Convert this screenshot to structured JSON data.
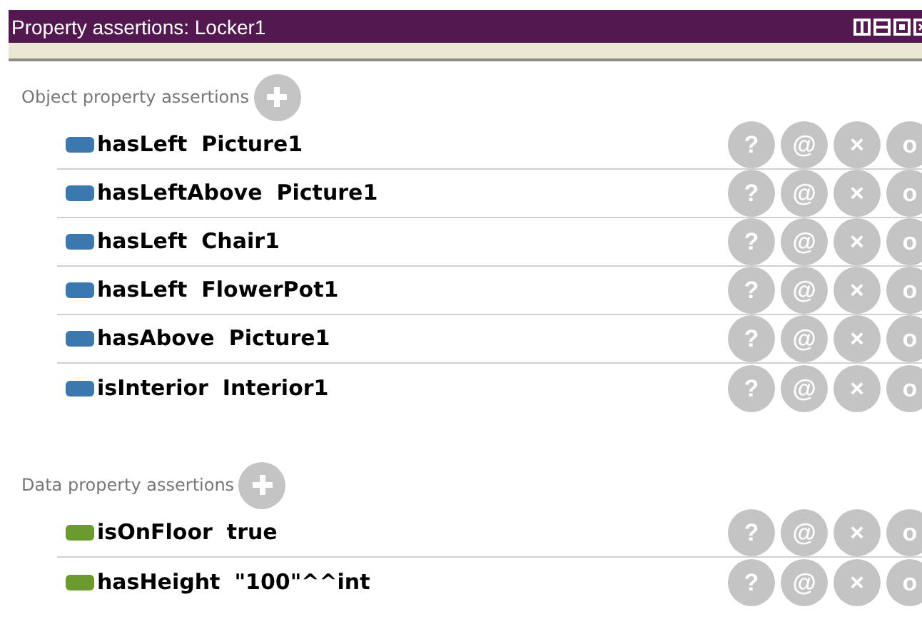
{
  "window": {
    "title": "Property assertions: Locker1"
  },
  "sections": [
    {
      "kind": "object",
      "label": "Object property assertions",
      "rows": [
        {
          "property": "hasLeft",
          "value": "Picture1",
          "buttons": [
            "?",
            "@",
            "×",
            "o"
          ]
        },
        {
          "property": "hasLeftAbove",
          "value": "Picture1",
          "buttons": [
            "?",
            "@",
            "×",
            "o"
          ]
        },
        {
          "property": "hasLeft",
          "value": "Chair1",
          "buttons": [
            "?",
            "@",
            "×",
            "o"
          ]
        },
        {
          "property": "hasLeft",
          "value": "FlowerPot1",
          "buttons": [
            "?",
            "@",
            "×",
            "o"
          ]
        },
        {
          "property": "hasAbove",
          "value": "Picture1",
          "buttons": [
            "?",
            "@",
            "×",
            "o"
          ]
        },
        {
          "property": "isInterior",
          "value": "Interior1",
          "buttons": [
            "?",
            "@",
            "×",
            "o"
          ]
        }
      ]
    },
    {
      "kind": "data",
      "label": "Data property assertions",
      "rows": [
        {
          "property": "isOnFloor",
          "value": "true",
          "buttons": [
            "?",
            "@",
            "×",
            "o"
          ]
        },
        {
          "property": "hasHeight",
          "value": "\"100\"^^int",
          "buttons": [
            "?",
            "@",
            "×",
            "o"
          ]
        }
      ]
    }
  ]
}
